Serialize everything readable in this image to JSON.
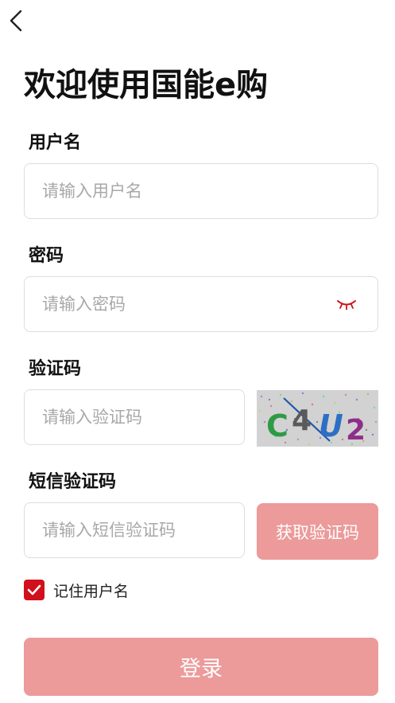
{
  "header": {
    "back_icon": "chevron-left-icon",
    "title": "欢迎使用国能e购"
  },
  "form": {
    "username": {
      "label": "用户名",
      "placeholder": "请输入用户名",
      "value": ""
    },
    "password": {
      "label": "密码",
      "placeholder": "请输入密码",
      "value": "",
      "toggle_icon": "eye-closed-icon"
    },
    "captcha": {
      "label": "验证码",
      "placeholder": "请输入验证码",
      "value": "",
      "image_text": [
        "C",
        "4",
        "U",
        "2"
      ]
    },
    "sms_code": {
      "label": "短信验证码",
      "placeholder": "请输入短信验证码",
      "value": "",
      "button_label": "获取验证码"
    },
    "remember": {
      "label": "记住用户名",
      "checked": true
    },
    "login_label": "登录"
  },
  "colors": {
    "accent": "#d0101b",
    "button_disabled": "#ec9a9a",
    "border": "#dddddd",
    "placeholder": "#a8a8a8"
  }
}
